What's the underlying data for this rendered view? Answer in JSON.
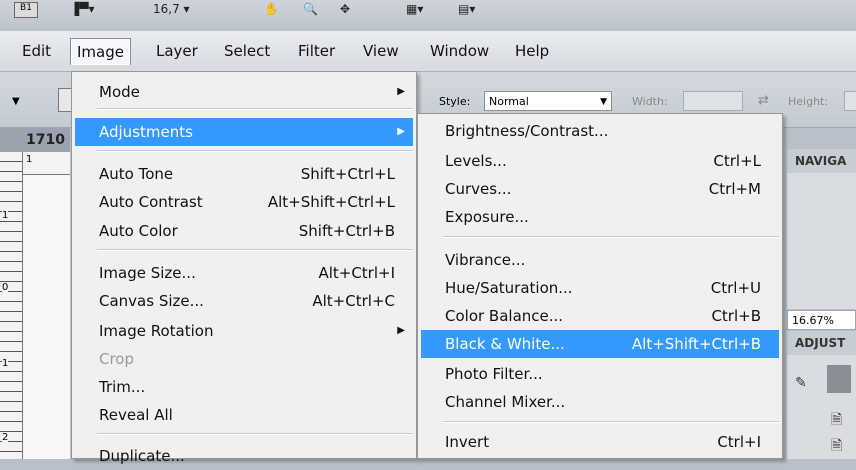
{
  "top_strip": {
    "box1": "B1",
    "zoom_text": "16,7",
    "hand_icon": "hand-icon",
    "zoom_icon": "zoom-icon",
    "rotate_icon": "rotate-view-icon"
  },
  "menubar": {
    "items": [
      {
        "label": "Edit"
      },
      {
        "label": "Image"
      },
      {
        "label": "Layer"
      },
      {
        "label": "Select"
      },
      {
        "label": "Filter"
      },
      {
        "label": "View"
      },
      {
        "label": "Window"
      },
      {
        "label": "Help"
      }
    ]
  },
  "options_bar": {
    "style_label": "Style:",
    "style_value": "Normal",
    "width_label": "Width:",
    "height_label": "Height:"
  },
  "document": {
    "tab_label": "1710",
    "ruler_numbers": [
      "1",
      "1",
      "0",
      "1",
      "2"
    ]
  },
  "panels": {
    "navigator_title": "NAVIGA",
    "zoom_value": "16.67%",
    "adjustments_title": "ADJUST"
  },
  "image_menu": {
    "items": [
      {
        "label": "Mode",
        "shortcut": "",
        "submenu": true
      },
      {
        "label": "Adjustments",
        "shortcut": "",
        "submenu": true,
        "highlighted": true
      },
      {
        "label": "Auto Tone",
        "shortcut": "Shift+Ctrl+L"
      },
      {
        "label": "Auto Contrast",
        "shortcut": "Alt+Shift+Ctrl+L"
      },
      {
        "label": "Auto Color",
        "shortcut": "Shift+Ctrl+B"
      },
      {
        "label": "Image Size...",
        "shortcut": "Alt+Ctrl+I"
      },
      {
        "label": "Canvas Size...",
        "shortcut": "Alt+Ctrl+C"
      },
      {
        "label": "Image Rotation",
        "shortcut": "",
        "submenu": true
      },
      {
        "label": "Crop",
        "shortcut": "",
        "disabled": true
      },
      {
        "label": "Trim...",
        "shortcut": ""
      },
      {
        "label": "Reveal All",
        "shortcut": ""
      },
      {
        "label": "Duplicate...",
        "shortcut": ""
      }
    ]
  },
  "adjustments_menu": {
    "items": [
      {
        "label": "Brightness/Contrast...",
        "shortcut": ""
      },
      {
        "label": "Levels...",
        "shortcut": "Ctrl+L"
      },
      {
        "label": "Curves...",
        "shortcut": "Ctrl+M"
      },
      {
        "label": "Exposure...",
        "shortcut": ""
      },
      {
        "label": "Vibrance...",
        "shortcut": ""
      },
      {
        "label": "Hue/Saturation...",
        "shortcut": "Ctrl+U"
      },
      {
        "label": "Color Balance...",
        "shortcut": "Ctrl+B"
      },
      {
        "label": "Black & White...",
        "shortcut": "Alt+Shift+Ctrl+B",
        "highlighted": true
      },
      {
        "label": "Photo Filter...",
        "shortcut": ""
      },
      {
        "label": "Channel Mixer...",
        "shortcut": ""
      },
      {
        "label": "Invert",
        "shortcut": "Ctrl+I"
      }
    ]
  },
  "colors": {
    "highlight": "#3399ff",
    "menu_bg": "#f0f0f0",
    "chrome_bg": "#d6dbe1"
  }
}
